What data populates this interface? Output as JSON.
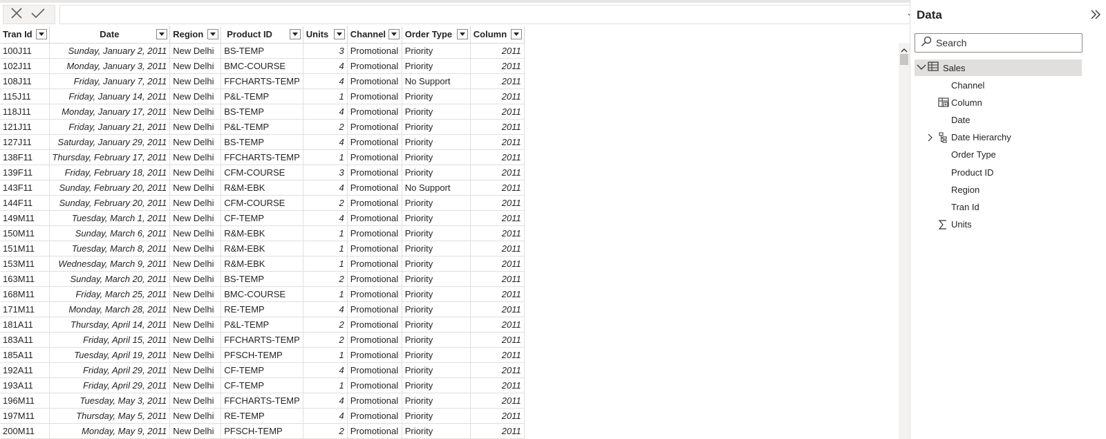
{
  "formula_bar": {
    "cancel_icon": "close-icon",
    "commit_icon": "check-icon",
    "value": ""
  },
  "table": {
    "columns": [
      "Tran Id",
      "Date",
      "Region",
      "Product ID",
      "Units",
      "Channel",
      "Order Type",
      "Column"
    ],
    "rows": [
      [
        "100J11",
        "Sunday, January 2, 2011",
        "New Delhi",
        "BS-TEMP",
        "3",
        "Promotional",
        "Priority",
        "2011"
      ],
      [
        "102J11",
        "Monday, January 3, 2011",
        "New Delhi",
        "BMC-COURSE",
        "4",
        "Promotional",
        "Priority",
        "2011"
      ],
      [
        "108J11",
        "Friday, January 7, 2011",
        "New Delhi",
        "FFCHARTS-TEMP",
        "4",
        "Promotional",
        "No Support",
        "2011"
      ],
      [
        "115J11",
        "Friday, January 14, 2011",
        "New Delhi",
        "P&L-TEMP",
        "1",
        "Promotional",
        "Priority",
        "2011"
      ],
      [
        "118J11",
        "Monday, January 17, 2011",
        "New Delhi",
        "BS-TEMP",
        "4",
        "Promotional",
        "Priority",
        "2011"
      ],
      [
        "121J11",
        "Friday, January 21, 2011",
        "New Delhi",
        "P&L-TEMP",
        "2",
        "Promotional",
        "Priority",
        "2011"
      ],
      [
        "127J11",
        "Saturday, January 29, 2011",
        "New Delhi",
        "BS-TEMP",
        "4",
        "Promotional",
        "Priority",
        "2011"
      ],
      [
        "138F11",
        "Thursday, February 17, 2011",
        "New Delhi",
        "FFCHARTS-TEMP",
        "1",
        "Promotional",
        "Priority",
        "2011"
      ],
      [
        "139F11",
        "Friday, February 18, 2011",
        "New Delhi",
        "CFM-COURSE",
        "3",
        "Promotional",
        "Priority",
        "2011"
      ],
      [
        "143F11",
        "Sunday, February 20, 2011",
        "New Delhi",
        "R&M-EBK",
        "4",
        "Promotional",
        "No Support",
        "2011"
      ],
      [
        "144F11",
        "Sunday, February 20, 2011",
        "New Delhi",
        "CFM-COURSE",
        "2",
        "Promotional",
        "Priority",
        "2011"
      ],
      [
        "149M11",
        "Tuesday, March 1, 2011",
        "New Delhi",
        "CF-TEMP",
        "4",
        "Promotional",
        "Priority",
        "2011"
      ],
      [
        "150M11",
        "Sunday, March 6, 2011",
        "New Delhi",
        "R&M-EBK",
        "1",
        "Promotional",
        "Priority",
        "2011"
      ],
      [
        "151M11",
        "Tuesday, March 8, 2011",
        "New Delhi",
        "R&M-EBK",
        "1",
        "Promotional",
        "Priority",
        "2011"
      ],
      [
        "153M11",
        "Wednesday, March 9, 2011",
        "New Delhi",
        "R&M-EBK",
        "1",
        "Promotional",
        "Priority",
        "2011"
      ],
      [
        "163M11",
        "Sunday, March 20, 2011",
        "New Delhi",
        "BS-TEMP",
        "2",
        "Promotional",
        "Priority",
        "2011"
      ],
      [
        "168M11",
        "Friday, March 25, 2011",
        "New Delhi",
        "BMC-COURSE",
        "1",
        "Promotional",
        "Priority",
        "2011"
      ],
      [
        "171M11",
        "Monday, March 28, 2011",
        "New Delhi",
        "RE-TEMP",
        "4",
        "Promotional",
        "Priority",
        "2011"
      ],
      [
        "181A11",
        "Thursday, April 14, 2011",
        "New Delhi",
        "P&L-TEMP",
        "2",
        "Promotional",
        "Priority",
        "2011"
      ],
      [
        "183A11",
        "Friday, April 15, 2011",
        "New Delhi",
        "FFCHARTS-TEMP",
        "2",
        "Promotional",
        "Priority",
        "2011"
      ],
      [
        "185A11",
        "Tuesday, April 19, 2011",
        "New Delhi",
        "PFSCH-TEMP",
        "1",
        "Promotional",
        "Priority",
        "2011"
      ],
      [
        "192A11",
        "Friday, April 29, 2011",
        "New Delhi",
        "CF-TEMP",
        "4",
        "Promotional",
        "Priority",
        "2011"
      ],
      [
        "193A11",
        "Friday, April 29, 2011",
        "New Delhi",
        "CF-TEMP",
        "1",
        "Promotional",
        "Priority",
        "2011"
      ],
      [
        "196M11",
        "Tuesday, May 3, 2011",
        "New Delhi",
        "FFCHARTS-TEMP",
        "4",
        "Promotional",
        "Priority",
        "2011"
      ],
      [
        "197M11",
        "Thursday, May 5, 2011",
        "New Delhi",
        "RE-TEMP",
        "4",
        "Promotional",
        "Priority",
        "2011"
      ],
      [
        "200M11",
        "Monday, May 9, 2011",
        "New Delhi",
        "PFSCH-TEMP",
        "2",
        "Promotional",
        "Priority",
        "2011"
      ]
    ]
  },
  "data_pane": {
    "title": "Data",
    "search_placeholder": "Search",
    "table_name": "Sales",
    "fields": [
      {
        "label": "Channel",
        "icon": ""
      },
      {
        "label": "Column",
        "icon": "calculated-column-icon"
      },
      {
        "label": "Date",
        "icon": ""
      },
      {
        "label": "Date Hierarchy",
        "icon": "hierarchy-icon"
      },
      {
        "label": "Order Type",
        "icon": ""
      },
      {
        "label": "Product ID",
        "icon": ""
      },
      {
        "label": "Region",
        "icon": ""
      },
      {
        "label": "Tran Id",
        "icon": ""
      },
      {
        "label": "Units",
        "icon": "sigma-icon"
      }
    ]
  }
}
